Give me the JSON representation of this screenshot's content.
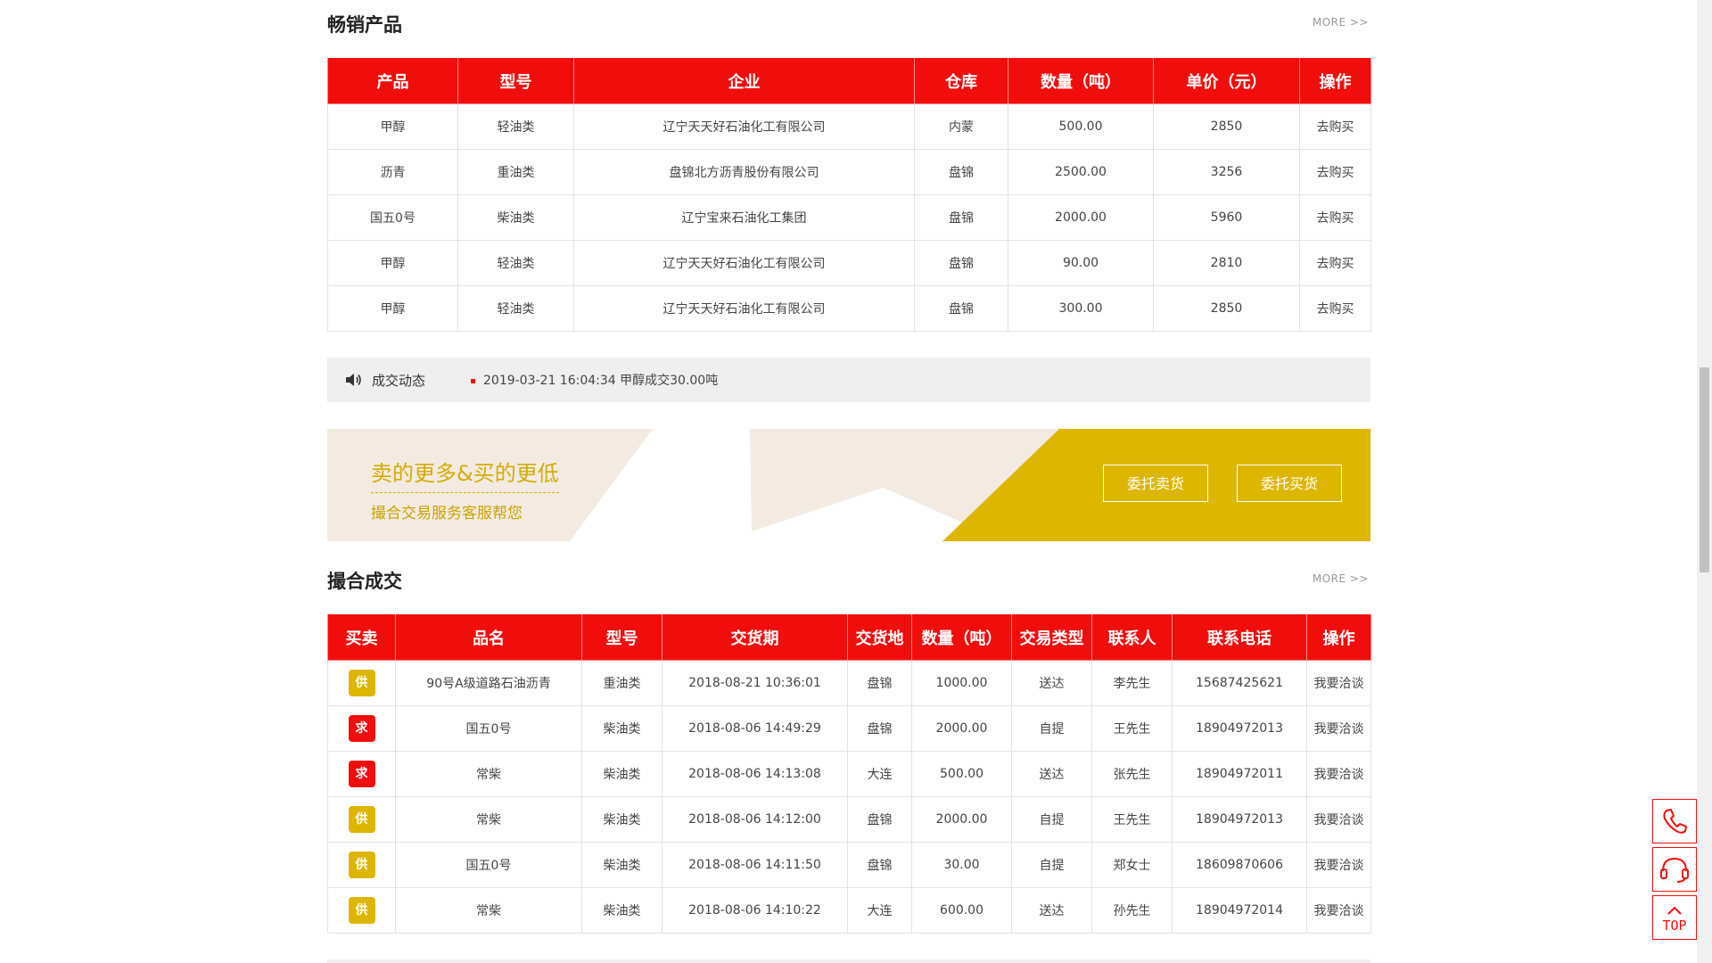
{
  "bestsellers": {
    "title": "畅销产品",
    "more": "MORE >>",
    "headers": [
      "产品",
      "型号",
      "企业",
      "仓库",
      "数量（吨）",
      "单价（元）",
      "操作"
    ],
    "rows": [
      [
        "甲醇",
        "轻油类",
        "辽宁天天好石油化工有限公司",
        "内蒙",
        "500.00",
        "2850",
        "去购买"
      ],
      [
        "沥青",
        "重油类",
        "盘锦北方沥青股份有限公司",
        "盘锦",
        "2500.00",
        "3256",
        "去购买"
      ],
      [
        "国五0号",
        "柴油类",
        "辽宁宝来石油化工集团",
        "盘锦",
        "2000.00",
        "5960",
        "去购买"
      ],
      [
        "甲醇",
        "轻油类",
        "辽宁天天好石油化工有限公司",
        "盘锦",
        "90.00",
        "2810",
        "去购买"
      ],
      [
        "甲醇",
        "轻油类",
        "辽宁天天好石油化工有限公司",
        "盘锦",
        "300.00",
        "2850",
        "去购买"
      ]
    ]
  },
  "deal_news": {
    "label": "成交动态",
    "item": "2019-03-21 16:04:34 甲醇成交30.00吨",
    "icon": "speaker-icon"
  },
  "banner": {
    "title": "卖的更多&买的更低",
    "subtitle": "撮合交易服务客服帮您",
    "sell_button": "委托卖货",
    "buy_button": "委托买货",
    "colors": {
      "accent": "#ddb600",
      "background": "#f3ebe1"
    }
  },
  "matched": {
    "title": "撮合成交",
    "more": "MORE >>",
    "headers": [
      "买卖",
      "品名",
      "型号",
      "交货期",
      "交货地",
      "数量（吨）",
      "交易类型",
      "联系人",
      "联系电话",
      "操作"
    ],
    "rows": [
      [
        "供",
        "90号A级道路石油沥青",
        "重油类",
        "2018-08-21 10:36:01",
        "盘锦",
        "1000.00",
        "送达",
        "李先生",
        "15687425621",
        "我要洽谈"
      ],
      [
        "求",
        "国五0号",
        "柴油类",
        "2018-08-06 14:49:29",
        "盘锦",
        "2000.00",
        "自提",
        "王先生",
        "18904972013",
        "我要洽谈"
      ],
      [
        "求",
        "常柴",
        "柴油类",
        "2018-08-06 14:13:08",
        "大连",
        "500.00",
        "送达",
        "张先生",
        "18904972011",
        "我要洽谈"
      ],
      [
        "供",
        "常柴",
        "柴油类",
        "2018-08-06 14:12:00",
        "盘锦",
        "2000.00",
        "自提",
        "王先生",
        "18904972013",
        "我要洽谈"
      ],
      [
        "供",
        "国五0号",
        "柴油类",
        "2018-08-06 14:11:50",
        "盘锦",
        "30.00",
        "自提",
        "郑女士",
        "18609870606",
        "我要洽谈"
      ],
      [
        "供",
        "常柴",
        "柴油类",
        "2018-08-06 14:10:22",
        "大连",
        "600.00",
        "送达",
        "孙先生",
        "18904972014",
        "我要洽谈"
      ]
    ],
    "tag_colors": {
      "供": "#ddb600",
      "求": "#f20d0d"
    }
  },
  "float_tools": {
    "phone_icon": "phone-icon",
    "service_icon": "headset-icon",
    "top_label": "TOP"
  },
  "theme": {
    "primary": "#f20d0d"
  }
}
